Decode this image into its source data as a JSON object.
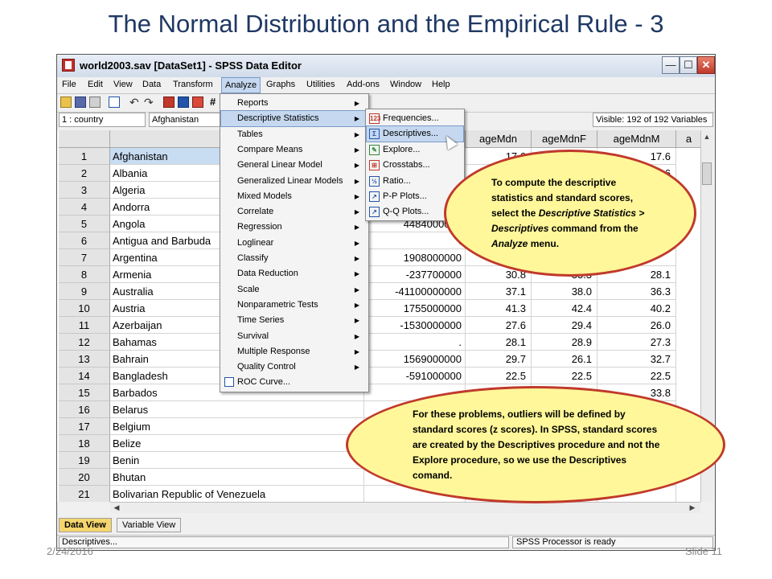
{
  "slide": {
    "title": "The Normal Distribution and the Empirical Rule - 3",
    "date": "2/24/2016",
    "slide_number": "Slide 11"
  },
  "window": {
    "title": "world2003.sav [DataSet1] - SPSS Data Editor",
    "buttons": {
      "min": "—",
      "max": "☐",
      "close": "✕"
    }
  },
  "menubar": [
    "File",
    "Edit",
    "View",
    "Data",
    "Transform",
    "Analyze",
    "Graphs",
    "Utilities",
    "Add-ons",
    "Window",
    "Help"
  ],
  "cell_ref": {
    "ref": "1 : country",
    "value": "Afghanistan"
  },
  "visible_status": "Visible: 192 of 192 Variables",
  "columns": [
    "ageMdn",
    "ageMdnF",
    "ageMdnM",
    "a"
  ],
  "rows": [
    {
      "num": "1",
      "country": "Afghanistan",
      "v1": "",
      "v2": "17.6",
      "v3": "17.6",
      "v4": "17.6"
    },
    {
      "num": "2",
      "country": "Albania",
      "v1": "",
      "v2": "",
      "v3": "",
      "v4": "28.6"
    },
    {
      "num": "3",
      "country": "Algeria",
      "v1": "",
      "v2": "",
      "v3": "",
      "v4": ""
    },
    {
      "num": "4",
      "country": "Andorra",
      "v1": "",
      "v2": "",
      "v3": "",
      "v4": ""
    },
    {
      "num": "5",
      "country": "Angola",
      "v1": "4484000000",
      "v2": "",
      "v3": "",
      "v4": ""
    },
    {
      "num": "6",
      "country": "Antigua and Barbuda",
      "v1": ".",
      "v2": "",
      "v3": "",
      "v4": ""
    },
    {
      "num": "7",
      "country": "Argentina",
      "v1": "1908000000",
      "v2": "",
      "v3": "",
      "v4": ""
    },
    {
      "num": "8",
      "country": "Armenia",
      "v1": "-237700000",
      "v2": "30.8",
      "v3": "33.3",
      "v4": "28.1"
    },
    {
      "num": "9",
      "country": "Australia",
      "v1": "-41100000000",
      "v2": "37.1",
      "v3": "38.0",
      "v4": "36.3"
    },
    {
      "num": "10",
      "country": "Austria",
      "v1": "1755000000",
      "v2": "41.3",
      "v3": "42.4",
      "v4": "40.2"
    },
    {
      "num": "11",
      "country": "Azerbaijan",
      "v1": "-1530000000",
      "v2": "27.6",
      "v3": "29.4",
      "v4": "26.0"
    },
    {
      "num": "12",
      "country": "Bahamas",
      "v1": ".",
      "v2": "28.1",
      "v3": "28.9",
      "v4": "27.3"
    },
    {
      "num": "13",
      "country": "Bahrain",
      "v1": "1569000000",
      "v2": "29.7",
      "v3": "26.1",
      "v4": "32.7"
    },
    {
      "num": "14",
      "country": "Bangladesh",
      "v1": "-591000000",
      "v2": "22.5",
      "v3": "22.5",
      "v4": "22.5"
    },
    {
      "num": "15",
      "country": "Barbados",
      "v1": "",
      "v2": "",
      "v3": "",
      "v4": "33.8"
    },
    {
      "num": "16",
      "country": "Belarus",
      "v1": "",
      "v2": "",
      "v3": "",
      "v4": ""
    },
    {
      "num": "17",
      "country": "Belgium",
      "v1": "",
      "v2": "",
      "v3": "",
      "v4": ""
    },
    {
      "num": "18",
      "country": "Belize",
      "v1": "",
      "v2": "",
      "v3": "",
      "v4": ""
    },
    {
      "num": "19",
      "country": "Benin",
      "v1": "",
      "v2": "",
      "v3": "",
      "v4": ""
    },
    {
      "num": "20",
      "country": "Bhutan",
      "v1": "",
      "v2": "",
      "v3": "",
      "v4": ""
    },
    {
      "num": "21",
      "country": "Bolivarian Republic of Venezuela",
      "v1": "",
      "v2": "",
      "v3": "",
      "v4": ""
    }
  ],
  "analyze_menu": [
    {
      "label": "Reports",
      "arrow": true
    },
    {
      "label": "Descriptive Statistics",
      "arrow": true
    },
    {
      "label": "Tables",
      "arrow": true
    },
    {
      "label": "Compare Means",
      "arrow": true
    },
    {
      "label": "General Linear Model",
      "arrow": true
    },
    {
      "label": "Generalized Linear Models",
      "arrow": true
    },
    {
      "label": "Mixed Models",
      "arrow": true
    },
    {
      "label": "Correlate",
      "arrow": true
    },
    {
      "label": "Regression",
      "arrow": true
    },
    {
      "label": "Loglinear",
      "arrow": true
    },
    {
      "label": "Classify",
      "arrow": true
    },
    {
      "label": "Data Reduction",
      "arrow": true
    },
    {
      "label": "Scale",
      "arrow": true
    },
    {
      "label": "Nonparametric Tests",
      "arrow": true
    },
    {
      "label": "Time Series",
      "arrow": true
    },
    {
      "label": "Survival",
      "arrow": true
    },
    {
      "label": "Multiple Response",
      "arrow": true
    },
    {
      "label": "Quality Control",
      "arrow": true
    },
    {
      "label": "ROC Curve...",
      "arrow": false
    }
  ],
  "descriptive_submenu": [
    {
      "label": "Frequencies...",
      "icon": "123"
    },
    {
      "label": "Descriptives...",
      "icon": "Σ"
    },
    {
      "label": "Explore...",
      "icon": "✎"
    },
    {
      "label": "Crosstabs...",
      "icon": "⊞"
    },
    {
      "label": "Ratio...",
      "icon": "½"
    },
    {
      "label": "P-P Plots...",
      "icon": "↗"
    },
    {
      "label": "Q-Q Plots...",
      "icon": "↗"
    }
  ],
  "tabs": [
    "Data View",
    "Variable View"
  ],
  "status": {
    "left": "Descriptives...",
    "right": "SPSS  Processor is ready"
  },
  "callouts": {
    "top": {
      "before": "To compute the descriptive statistics and standard scores, select the ",
      "italic": "Descriptive Statistics > Descriptives",
      "middle": " command from the ",
      "italic2": "Analyze",
      "after": " menu."
    },
    "bottom": "For these  problems, outliers will be defined by standard scores (z scores). In SPSS, standard scores are created by the Descriptives procedure and not the Explore procedure, so we use the Descriptives comand."
  },
  "colors": {
    "accent": "#1f3864",
    "callout_fill": "#fff799",
    "callout_border": "#c0392b",
    "highlight": "#c5d8f0"
  }
}
